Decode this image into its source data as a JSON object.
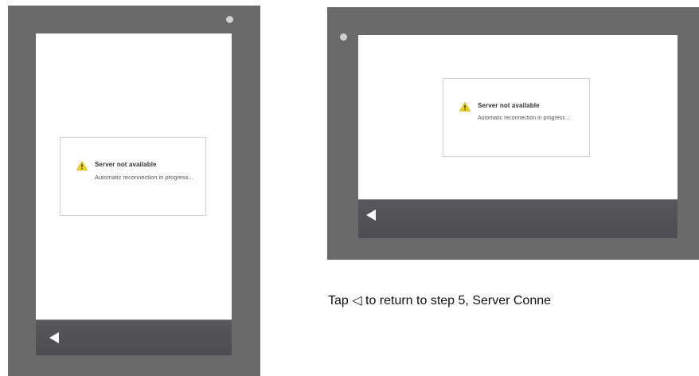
{
  "dialog": {
    "title": "Server not available",
    "message_portrait": "Automatic reconnection in progress...",
    "message_landscape": "Automatic reconnection in progress ..",
    "icon": "warning-triangle-icon",
    "icon_color": "#f2d400"
  },
  "navbar": {
    "back_icon": "back-arrow-icon"
  },
  "caption": {
    "text": "Tap ◁ to return to step 5, Server Conne"
  },
  "colors": {
    "bezel": "#6b6a6b",
    "screen": "#ffffff",
    "navbar": "#4f4e51"
  }
}
